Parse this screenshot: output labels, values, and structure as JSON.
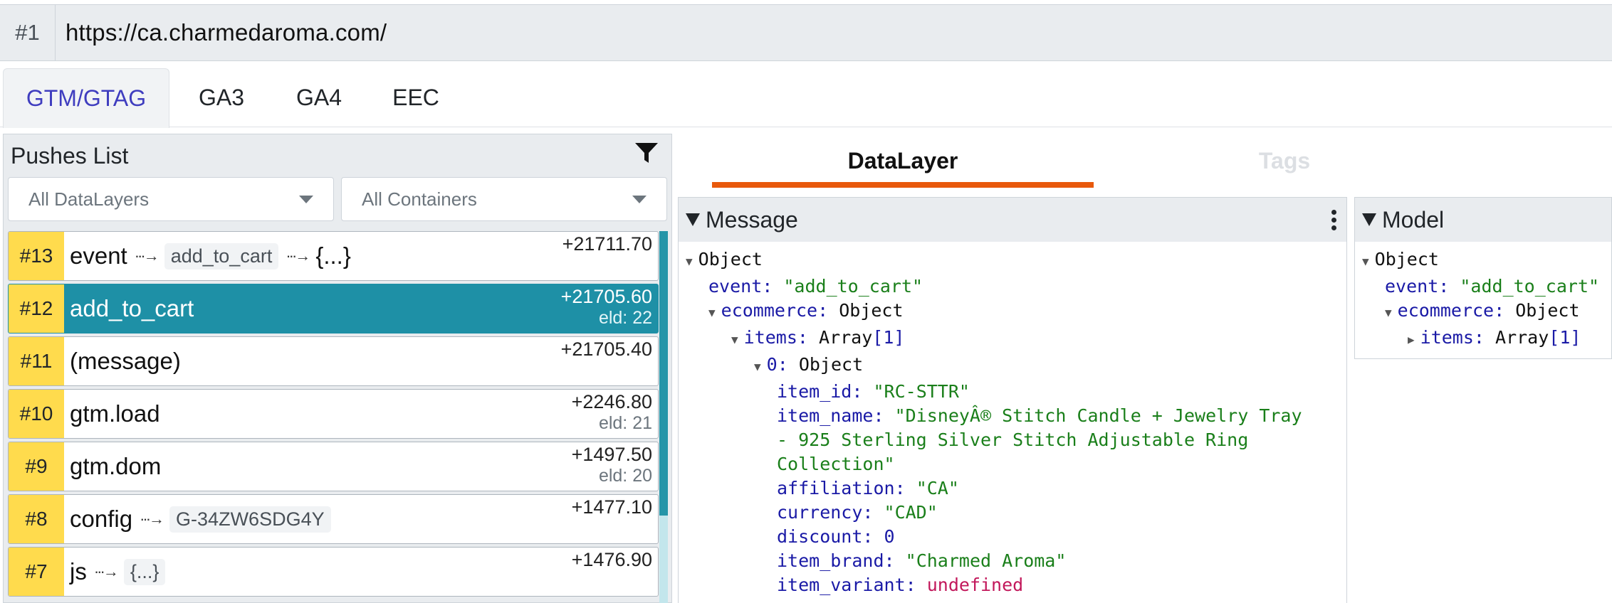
{
  "url_bar": {
    "index": "#1",
    "url": "https://ca.charmedaroma.com/"
  },
  "tabs": [
    "GTM/GTAG",
    "GA3",
    "GA4",
    "EEC"
  ],
  "active_tab": "GTM/GTAG",
  "pushes_panel": {
    "title": "Pushes List",
    "filter_icon": "filter-icon",
    "datalayer_select": "All DataLayers",
    "containers_select": "All Containers",
    "items": [
      {
        "index": "#13",
        "label": "event",
        "arg": "add_to_cart",
        "tail": "{...}",
        "time": "+21711.70",
        "eld": ""
      },
      {
        "index": "#12",
        "label": "add_to_cart",
        "arg": "",
        "tail": "",
        "time": "+21705.60",
        "eld": "eld: 22",
        "selected": true
      },
      {
        "index": "#11",
        "label": "(message)",
        "arg": "",
        "tail": "",
        "time": "+21705.40",
        "eld": ""
      },
      {
        "index": "#10",
        "label": "gtm.load",
        "arg": "",
        "tail": "",
        "time": "+2246.80",
        "eld": "eld: 21"
      },
      {
        "index": "#9",
        "label": "gtm.dom",
        "arg": "",
        "tail": "",
        "time": "+1497.50",
        "eld": "eld: 20"
      },
      {
        "index": "#8",
        "label": "config",
        "arg": "G-34ZW6SDG4Y",
        "tail": "",
        "time": "+1477.10",
        "eld": ""
      },
      {
        "index": "#7",
        "label": "js",
        "arg": "{...}",
        "tail": "",
        "time": "+1476.90",
        "eld": ""
      }
    ]
  },
  "right_tabs": {
    "datalayer": "DataLayer",
    "tags": "Tags"
  },
  "message_panel": {
    "title": "Message",
    "root": "Object",
    "event_key": "event:",
    "event_val": "\"add_to_cart\"",
    "ecommerce_key": "ecommerce:",
    "ecommerce_val": "Object",
    "items_key": "items:",
    "items_type": "Array",
    "items_len": "[1]",
    "zero_key": "0:",
    "zero_val": "Object",
    "item_id_key": "item_id:",
    "item_id_val": "\"RC-STTR\"",
    "item_name_key": "item_name:",
    "item_name_val": "\"DisneyÂ® Stitch Candle + Jewelry Tray - 925 Sterling Silver Stitch Adjustable Ring Collection\"",
    "affiliation_key": "affiliation:",
    "affiliation_val": "\"CA\"",
    "currency_key": "currency:",
    "currency_val": "\"CAD\"",
    "discount_key": "discount:",
    "discount_val": "0",
    "item_brand_key": "item_brand:",
    "item_brand_val": "\"Charmed Aroma\"",
    "item_variant_key": "item_variant:",
    "item_variant_val": "undefined"
  },
  "model_panel": {
    "title": "Model",
    "root": "Object",
    "event_key": "event:",
    "event_val": "\"add_to_cart\"",
    "ecommerce_key": "ecommerce:",
    "ecommerce_val": "Object",
    "items_key": "items:",
    "items_type": "Array",
    "items_len": "[1]"
  }
}
